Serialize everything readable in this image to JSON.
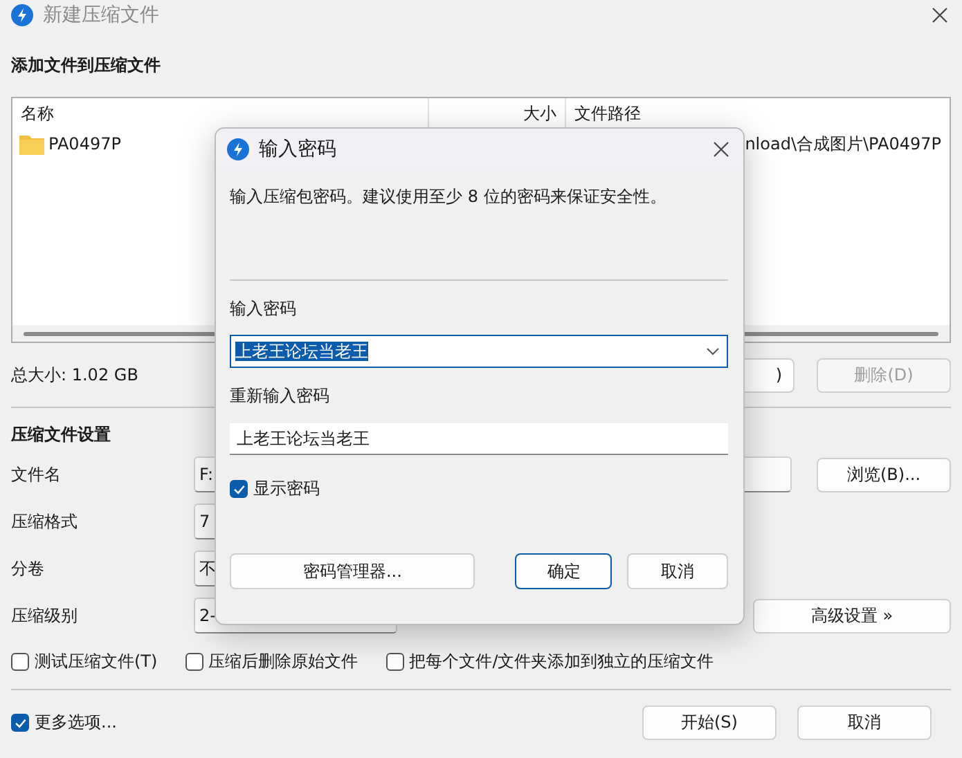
{
  "window": {
    "title": "新建压缩文件"
  },
  "add_section": {
    "heading": "添加文件到压缩文件",
    "file_list": {
      "columns": [
        "名称",
        "大小",
        "文件路径"
      ],
      "rows": [
        {
          "name": "PA0497P",
          "path": "nload\\合成图片\\PA0497P"
        }
      ]
    },
    "total_size": "总大小: 1.02 GB",
    "buttons": [
      {
        "label": ")",
        "disabled": false
      },
      {
        "label": "删除(D)",
        "disabled": true
      }
    ]
  },
  "settings": {
    "heading": "压缩文件设置",
    "fields": [
      {
        "label": "文件名",
        "value": "F:",
        "kind": "path",
        "button": "浏览(B)..."
      },
      {
        "label": "压缩格式",
        "value": "7",
        "kind": "select"
      },
      {
        "label": "分卷",
        "value": "不",
        "kind": "select"
      },
      {
        "label": "压缩级别",
        "value": "2-",
        "kind": "select",
        "button": "高级设置 »"
      }
    ],
    "options": [
      {
        "label": "测试压缩文件(T)",
        "checked": false
      },
      {
        "label": "压缩后删除原始文件",
        "checked": false
      },
      {
        "label": "把每个文件/文件夹添加到独立的压缩文件",
        "checked": false
      }
    ]
  },
  "more_options": {
    "label": "更多选项...",
    "checked": true
  },
  "footer_buttons": [
    "开始(S)",
    "取消"
  ],
  "dialog": {
    "title": "输入密码",
    "description": "输入压缩包密码。建议使用至少 8 位的密码来保证安全性。",
    "password_label": "输入密码",
    "password": {
      "value": "上老王论坛当老王",
      "selected": true
    },
    "confirm_label": "重新输入密码",
    "confirm_value": "上老王论坛当老王",
    "show_password": {
      "label": "显示密码",
      "checked": true
    },
    "buttons": [
      {
        "label": "密码管理器...",
        "kind": "manager"
      },
      {
        "label": "确定",
        "kind": "default"
      },
      {
        "label": "取消",
        "kind": "normal"
      }
    ]
  }
}
